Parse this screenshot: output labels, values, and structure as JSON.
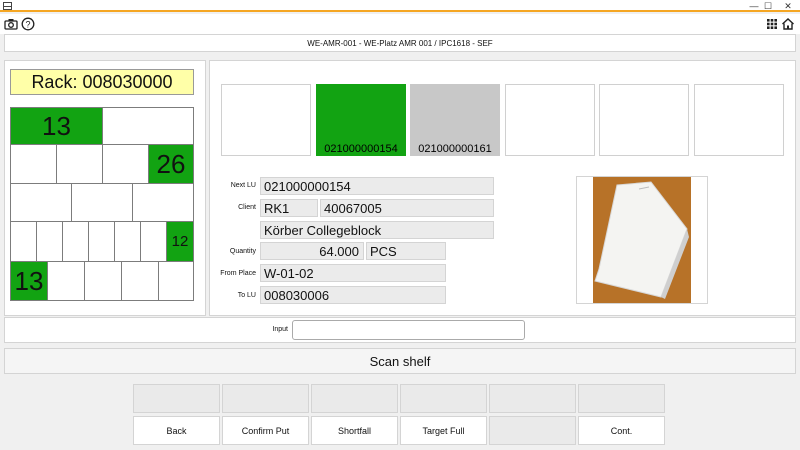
{
  "subtitle": "WE-AMR-001 - WE-Platz AMR 001 / IPC1618 - SEF",
  "window_controls": [
    "—",
    "☐",
    "✕"
  ],
  "rack": {
    "title": "Rack: 008030000",
    "cells": [
      "13",
      "26",
      "12",
      "13"
    ]
  },
  "thumbnails": [
    "",
    "021000000154",
    "021000000161",
    "",
    "",
    ""
  ],
  "form": {
    "next_lu_label": "Next LU",
    "next_lu": "021000000154",
    "client_label": "Client",
    "client_code": "RK1",
    "client_number": "40067005",
    "description": "Körber Collegeblock",
    "quantity_label": "Quantity",
    "quantity": "64.000",
    "unit": "PCS",
    "from_place_label": "From Place",
    "from_place": "W-01-02",
    "to_lu_label": "To LU",
    "to_lu": "008030006"
  },
  "input": {
    "label": "Input",
    "value": ""
  },
  "scan_label": "Scan shelf",
  "buttons": {
    "back": "Back",
    "confirm_put": "Confirm Put",
    "shortfall": "Shortfall",
    "target_full": "Target Full",
    "cont": "Cont."
  },
  "colors": {
    "accent": "#f5a623",
    "slot_green": "#12a312",
    "slot_gray": "#c8c8c8",
    "rack_title_bg": "#ffffa8"
  },
  "icons": {
    "camera": "camera-icon",
    "help": "help-icon",
    "grid": "grid-icon",
    "home": "home-icon"
  }
}
